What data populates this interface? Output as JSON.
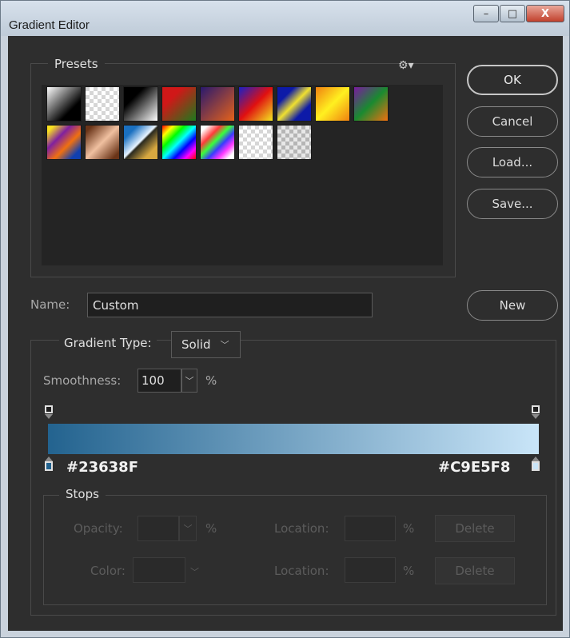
{
  "window": {
    "title": "Gradient Editor",
    "minimize_label": "–",
    "maximize_label": "□",
    "close_label": "X"
  },
  "presets": {
    "legend": "Presets",
    "gear_glyph": "⚙▾",
    "swatches": [
      {
        "id": "fg-bg",
        "css": "linear-gradient(135deg,#ffffff 0%,#000000 70%)"
      },
      {
        "id": "fg-transparent",
        "css": "checker-white"
      },
      {
        "id": "black-white",
        "css": "linear-gradient(135deg,#000000 30%,#ffffff 100%)"
      },
      {
        "id": "red-green",
        "css": "linear-gradient(135deg,#d01818 30%,#1c7a1c 100%)"
      },
      {
        "id": "violet-orange",
        "css": "linear-gradient(135deg,#29196e 0%,#e6621a 100%)"
      },
      {
        "id": "blue-red-yellow",
        "css": "linear-gradient(135deg,#1820c8 0%,#e01010 50%,#f3e820 100%)"
      },
      {
        "id": "blue-yellow-blue",
        "css": "linear-gradient(135deg,#0d1aa8 25%,#f0e030 50%,#0d1aa8 75%)"
      },
      {
        "id": "orange-yellow-orange",
        "css": "linear-gradient(135deg,#f08010 0%,#fff020 50%,#f08010 100%)"
      },
      {
        "id": "violet-green-orange",
        "css": "linear-gradient(135deg,#7a1aa0 0%,#1a8a30 50%,#f07010 100%)"
      },
      {
        "id": "yellow-violet-orange-blue",
        "css": "linear-gradient(135deg,#f8e020 10%,#8020a0 35%,#f07010 60%,#1040b0 85%)"
      },
      {
        "id": "copper",
        "css": "linear-gradient(135deg,#6a3418 10%,#f0c0a0 50%,#6a3418 90%)"
      },
      {
        "id": "chrome",
        "css": "linear-gradient(135deg,#1a70c0 20%,#e8f4ff 48%,#2a2a20 52%,#d8a840 80%)"
      },
      {
        "id": "spectrum",
        "css": "linear-gradient(135deg,#ff0000,#ffff00,#00ff00,#00ffff,#0000ff,#ff00ff,#ff0000)"
      },
      {
        "id": "transparent-rainbow",
        "css": "linear-gradient(135deg,#ffffff 10%,#ff3a3a 30%,#3aff3a 45%,#3a3aff 60%,#ff3aff 75%,#ffffff 90%)"
      },
      {
        "id": "transparent-stripes",
        "css": "checker-white"
      },
      {
        "id": "neutral-density",
        "css": "checker-grey"
      }
    ]
  },
  "buttons": {
    "ok": "OK",
    "cancel": "Cancel",
    "load": "Load...",
    "save": "Save...",
    "new": "New"
  },
  "name": {
    "label": "Name:",
    "value": "Custom"
  },
  "gradient": {
    "type_label": "Gradient Type:",
    "type_value": "Solid",
    "smoothness_label": "Smoothness:",
    "smoothness_value": "100",
    "smoothness_unit": "%",
    "start_color": "#23638F",
    "end_color": "#C9E5F8"
  },
  "stops": {
    "legend": "Stops",
    "opacity_label": "Opacity:",
    "opacity_unit": "%",
    "color_label": "Color:",
    "location_label": "Location:",
    "location_unit": "%",
    "delete_label": "Delete"
  }
}
